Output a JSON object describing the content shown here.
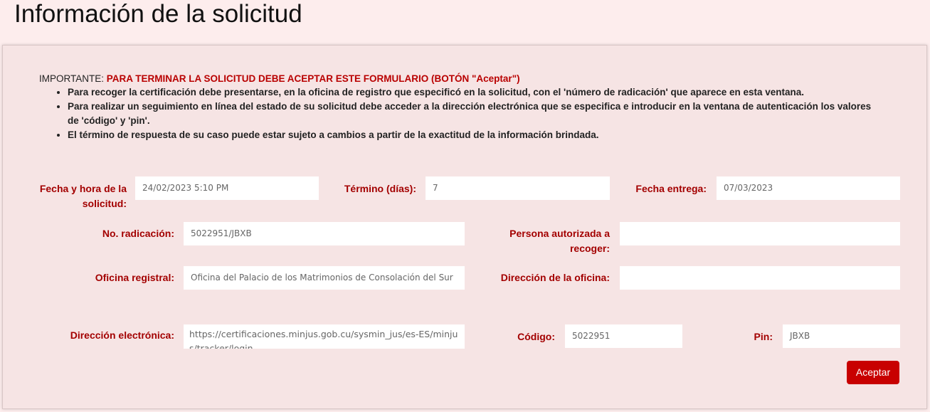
{
  "page": {
    "title": "Información de la solicitud"
  },
  "notice": {
    "important_label": "IMPORTANTE:",
    "warning": "PARA TERMINAR LA SOLICITUD DEBE ACEPTAR ESTE FORMULARIO (BOTÓN \"Aceptar\")",
    "items": [
      "Para recoger la certificación debe presentarse, en la oficina de registro que especificó en la solicitud, con el 'número de radicación' que aparece en esta ventana.",
      "Para realizar un seguimiento en línea del estado de su solicitud debe acceder a la dirección electrónica que se especifica e introducir en la ventana de autenticación los valores de 'código' y 'pin'.",
      "El término de respuesta de su caso puede estar sujeto a cambios a partir de la exactitud de la información brindada."
    ]
  },
  "form": {
    "fecha_hora": {
      "label": "Fecha y hora de la solicitud:",
      "value": "24/02/2023 5:10 PM"
    },
    "termino": {
      "label": "Término (días):",
      "value": "7"
    },
    "fecha_entrega": {
      "label": "Fecha entrega:",
      "value": "07/03/2023"
    },
    "radicacion": {
      "label": "No. radicación:",
      "value": "5022951/JBXB"
    },
    "persona_autorizada": {
      "label": "Persona autorizada a recoger:",
      "value": ""
    },
    "oficina_registral": {
      "label": "Oficina registral:",
      "value": "Oficina del Palacio de los Matrimonios de Consolación del Sur"
    },
    "direccion_oficina": {
      "label": "Dirección de la oficina:",
      "value": ""
    },
    "direccion_electronica": {
      "label": "Dirección electrónica:",
      "value": "https://certificaciones.minjus.gob.cu/sysmin_jus/es-ES/minjus/tracker/login"
    },
    "codigo": {
      "label": "Código:",
      "value": "5022951"
    },
    "pin": {
      "label": "Pin:",
      "value": "JBXB"
    }
  },
  "actions": {
    "accept_label": "Aceptar"
  },
  "colors": {
    "accent": "#c80000",
    "label": "#a30000",
    "background": "#fdeded",
    "panel": "#f6e4e4"
  }
}
